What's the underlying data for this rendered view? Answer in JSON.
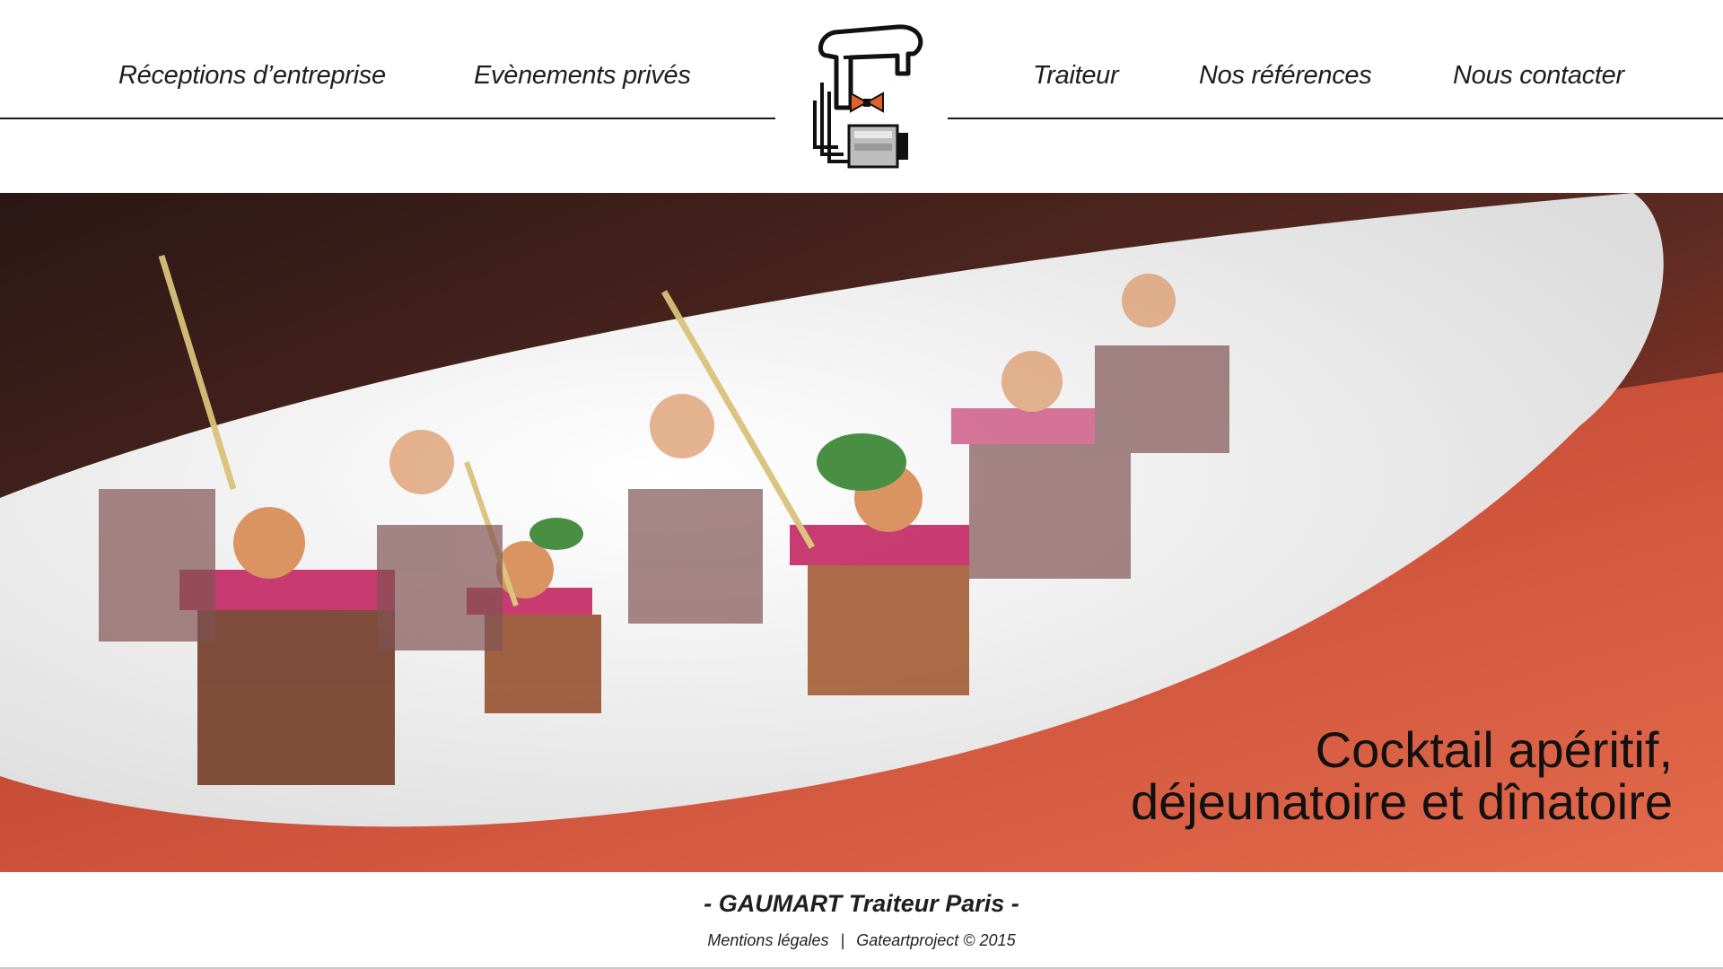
{
  "nav": {
    "left": [
      "Réceptions d’entreprise",
      "Evènements privés"
    ],
    "right": [
      "Traiteur",
      "Nos références",
      "Nous contacter"
    ]
  },
  "logo": {
    "icon": "chef-logo-icon",
    "accent": "#e2622b"
  },
  "hero": {
    "tagline_line1": "Cocktail apéritif,",
    "tagline_line2": "déjeunatoire et dînatoire"
  },
  "footer": {
    "brand": "- GAUMART Traiteur Paris -",
    "legal_link": "Mentions légales",
    "separator": "|",
    "credit": "Gateartproject © 2015"
  },
  "colors": {
    "text": "#1e1e1e",
    "accent": "#e2622b",
    "table": "#c2412a"
  }
}
